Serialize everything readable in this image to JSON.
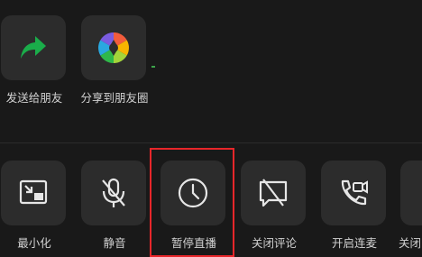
{
  "share_row": {
    "items": [
      {
        "label": "发送给朋友",
        "icon": "forward-arrow-icon"
      },
      {
        "label": "分享到朋友圈",
        "icon": "moments-aperture-icon"
      }
    ]
  },
  "control_row": {
    "items": [
      {
        "label": "最小化",
        "icon": "minimize-window-icon"
      },
      {
        "label": "静音",
        "icon": "mic-muted-icon"
      },
      {
        "label": "暂停直播",
        "icon": "clock-icon"
      },
      {
        "label": "关闭评论",
        "icon": "comment-off-icon"
      },
      {
        "label": "开启连麦",
        "icon": "phone-video-icon"
      },
      {
        "label": "关闭",
        "icon": "partial-icon"
      }
    ]
  },
  "colors": {
    "background": "#191919",
    "tile": "#2c2c2c",
    "forward_green": "#1aad4a",
    "highlight_red": "#e8262a",
    "icon_stroke": "#e6e6e6"
  }
}
